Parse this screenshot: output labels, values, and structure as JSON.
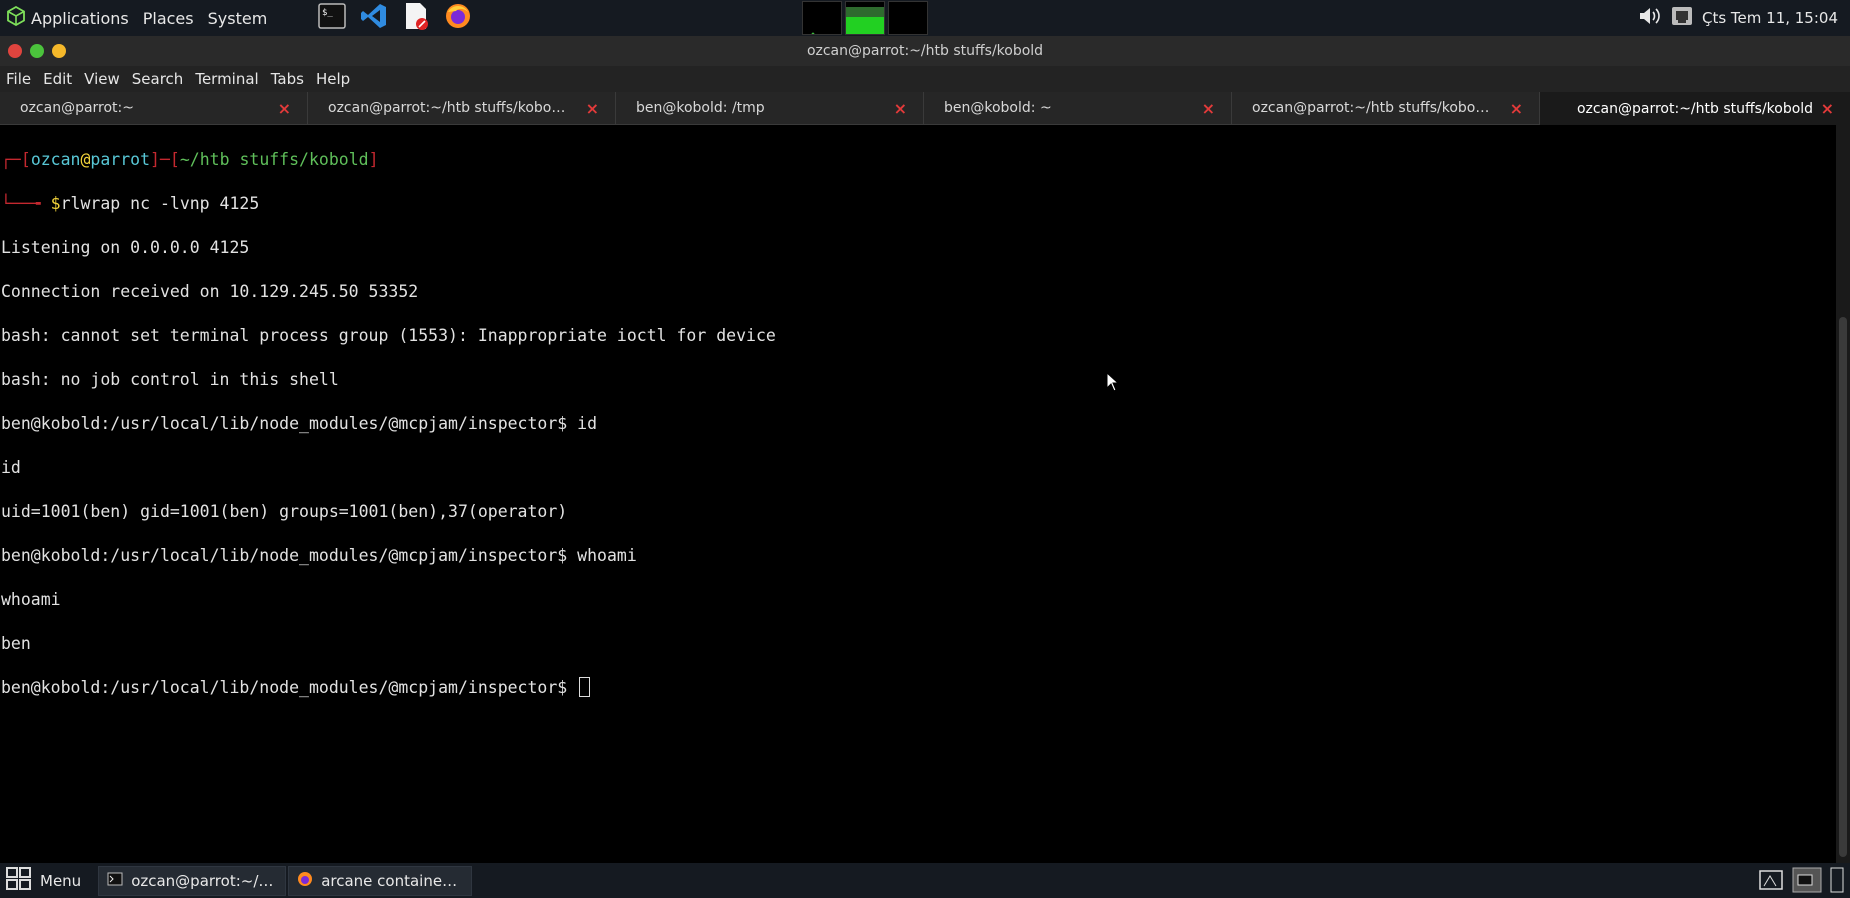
{
  "top_panel": {
    "applications": "Applications",
    "places": "Places",
    "system": "System",
    "clock": "Çts Tem 11, 15:04"
  },
  "window": {
    "title": "ozcan@parrot:~/htb stuffs/kobold"
  },
  "menubar": [
    "File",
    "Edit",
    "View",
    "Search",
    "Terminal",
    "Tabs",
    "Help"
  ],
  "tabs": [
    {
      "label": "ozcan@parrot:~",
      "close": "×"
    },
    {
      "label": "ozcan@parrot:~/htb stuffs/kobold/…",
      "close": "×"
    },
    {
      "label": "ben@kobold: /tmp",
      "close": "×"
    },
    {
      "label": "ben@kobold: ~",
      "close": "×"
    },
    {
      "label": "ozcan@parrot:~/htb stuffs/kobold/…",
      "close": "×"
    },
    {
      "label": "ozcan@parrot:~/htb stuffs/kobold",
      "close": "×"
    }
  ],
  "terminal": {
    "prompt": {
      "corner_top": "┌─[",
      "user": "ozcan",
      "at": "@",
      "host": "parrot",
      "sep": "]─[",
      "path": "~/htb stuffs/kobold",
      "end": "]",
      "corner_bottom": "└──╼ ",
      "dollar": "$",
      "command": "rlwrap nc -lvnp 4125"
    },
    "lines": [
      "Listening on 0.0.0.0 4125",
      "Connection received on 10.129.245.50 53352",
      "bash: cannot set terminal process group (1553): Inappropriate ioctl for device",
      "bash: no job control in this shell",
      "ben@kobold:/usr/local/lib/node_modules/@mcpjam/inspector$ id",
      "id",
      "uid=1001(ben) gid=1001(ben) groups=1001(ben),37(operator)",
      "ben@kobold:/usr/local/lib/node_modules/@mcpjam/inspector$ whoami",
      "whoami",
      "ben",
      "ben@kobold:/usr/local/lib/node_modules/@mcpjam/inspector$ "
    ]
  },
  "taskbar": {
    "menu": "Menu",
    "tasks": [
      {
        "label": "ozcan@parrot:~/htb s…",
        "icon": "terminal-icon"
      },
      {
        "label": "arcane container defa…",
        "icon": "firefox-icon"
      }
    ]
  },
  "colors": {
    "panel": "#151a21",
    "prompt_red": "#c4282f",
    "prompt_cyan": "#58c7d6",
    "prompt_yellow": "#f2d33a",
    "prompt_green": "#5fbf5a",
    "tab_close": "#e23a3a"
  }
}
